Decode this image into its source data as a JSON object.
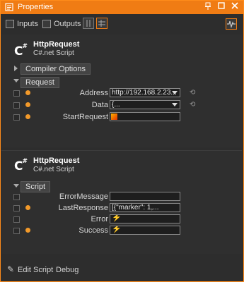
{
  "window": {
    "title": "Properties",
    "accent": "#f07c14"
  },
  "titlebar": {
    "pin_icon": "pin-icon",
    "maximize_icon": "maximize-icon",
    "close_icon": "close-icon"
  },
  "toolbar": {
    "inputs_label": "Inputs",
    "outputs_label": "Outputs"
  },
  "node1": {
    "title": "HttpRequest",
    "subtitle": "C#.net Script",
    "compiler_section": "Compiler Options",
    "request_section": "Request",
    "address_label": "Address",
    "address_value": "http://192.168.2.23...",
    "data_label": "Data",
    "data_value": "{...",
    "start_label": "StartRequest"
  },
  "node2": {
    "title": "HttpRequest",
    "subtitle": "C#.net Script",
    "script_section": "Script",
    "error_message_label": "ErrorMessage",
    "error_message_value": "",
    "last_response_label": "LastResponse",
    "last_response_value": "[{\"marker\": 1,...",
    "error_label": "Error",
    "success_label": "Success"
  },
  "footer": {
    "edit_script": "Edit Script",
    "debug": "Debug"
  }
}
